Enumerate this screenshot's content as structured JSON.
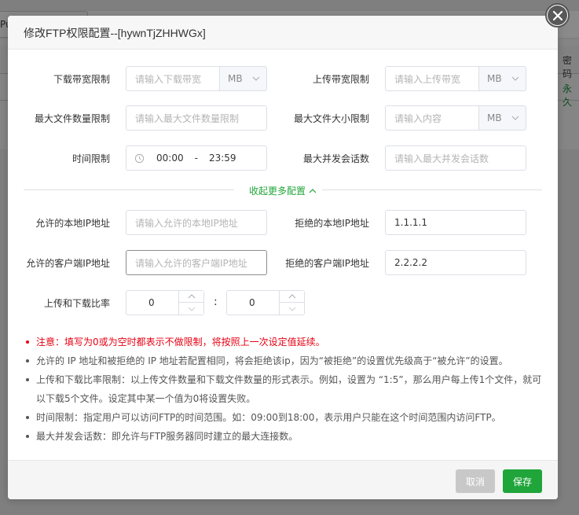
{
  "background": {
    "tab_partial": "Pu",
    "column_header_partial": "密码",
    "column_value_partial": "永久"
  },
  "dialog": {
    "title": "修改FTP权限配置--[hywnTjZHHWGx]",
    "close_icon": "close-icon",
    "fields": {
      "download_limit": {
        "label": "下载带宽限制",
        "placeholder": "请输入下载带宽",
        "unit": "MB"
      },
      "upload_limit": {
        "label": "上传带宽限制",
        "placeholder": "请输入上传带宽",
        "unit": "MB"
      },
      "max_files": {
        "label": "最大文件数量限制",
        "placeholder": "请输入最大文件数量限制"
      },
      "max_file_size": {
        "label": "最大文件大小限制",
        "placeholder": "请输入内容",
        "unit": "MB"
      },
      "time_limit": {
        "label": "时间限制",
        "start": "00:00",
        "separator": "-",
        "end": "23:59"
      },
      "max_sessions": {
        "label": "最大并发会话数",
        "placeholder": "请输入最大并发会话数"
      },
      "allowed_local_ip": {
        "label": "允许的本地IP地址",
        "placeholder": "请输入允许的本地IP地址"
      },
      "denied_local_ip": {
        "label": "拒绝的本地IP地址",
        "value": "1.1.1.1"
      },
      "allowed_client_ip": {
        "label": "允许的客户端IP地址",
        "placeholder": "请输入允许的客户端IP地址"
      },
      "denied_client_ip": {
        "label": "拒绝的客户端IP地址",
        "value": "2.2.2.2"
      },
      "ratio": {
        "label": "上传和下载比率",
        "upload": "0",
        "colon": ":",
        "download": "0"
      }
    },
    "collapse_link": "收起更多配置",
    "notes": [
      "注意：填写为0或为空时都表示不做限制，将按照上一次设定值延续。",
      "允许的 IP 地址和被拒绝的 IP 地址若配置相同，将会拒绝该ip，因为“被拒绝”的设置优先级高于“被允许”的设置。",
      "上传和下载比率限制：以上传文件数量和下载文件数量的形式表示。例如，设置为 “1:5”，那么用户每上传1个文件，就可以下载5个文件。设定其中某一个值为0将设置失败。",
      "时间限制：指定用户可以访问FTP的时间范围。如：09:00到18:00，表示用户只能在这个时间范围内访问FTP。",
      "最大并发会话数：即允许与FTP服务器同时建立的最大连接数。"
    ],
    "buttons": {
      "cancel": "取消",
      "save": "保存"
    }
  },
  "colors": {
    "accent": "#20a53a",
    "warning": "#e60012"
  }
}
